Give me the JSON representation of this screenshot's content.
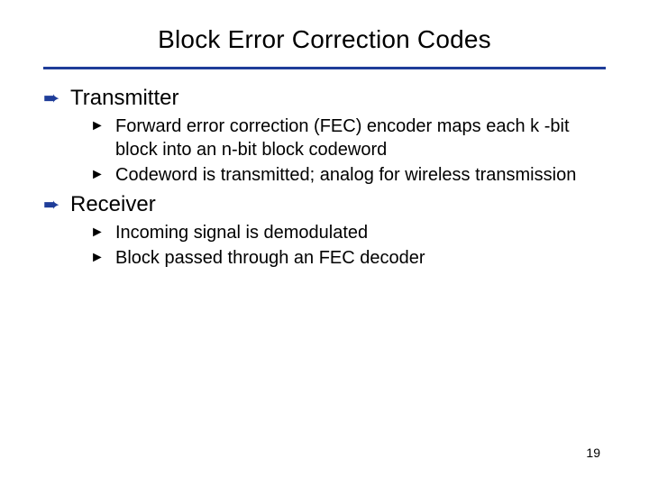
{
  "title": "Block Error Correction Codes",
  "sections": [
    {
      "heading": "Transmitter",
      "items": [
        "Forward error correction (FEC) encoder maps each k -bit block into an n-bit block codeword",
        "Codeword is transmitted; analog for wireless transmission"
      ]
    },
    {
      "heading": "Receiver",
      "items": [
        "Incoming signal is demodulated",
        "Block passed through an FEC decoder"
      ]
    }
  ],
  "bullets": {
    "level1": "➨",
    "level2": "►"
  },
  "page_number": "19"
}
